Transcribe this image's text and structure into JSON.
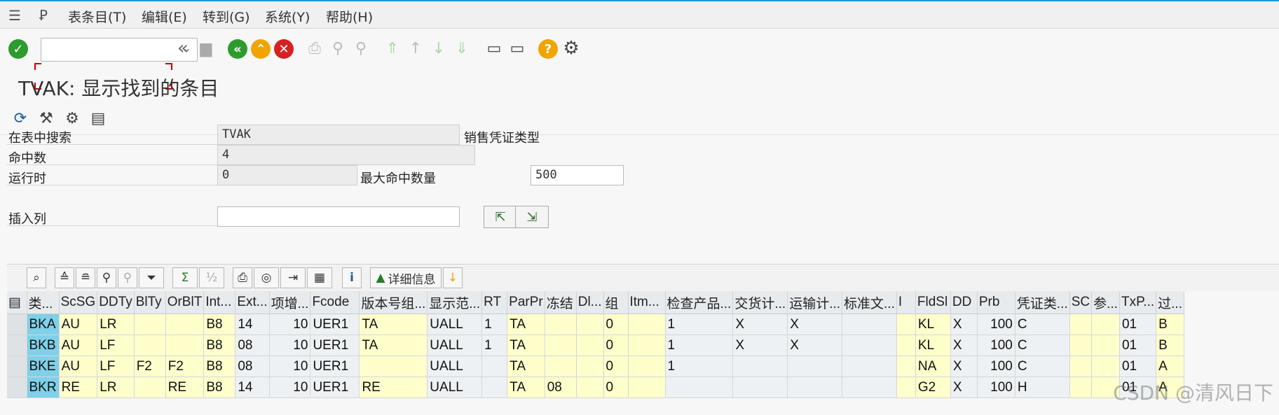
{
  "menu": {
    "items": [
      "表条目(T)",
      "编辑(E)",
      "转到(G)",
      "系统(Y)",
      "帮助(H)"
    ]
  },
  "toolbar": {
    "command_field_value": "",
    "icons": [
      "confirm-icon",
      "back-icon",
      "save-icon",
      "back-green-icon",
      "exit-icon",
      "cancel-icon",
      "print-icon",
      "find-icon",
      "find-next-icon",
      "first-page-icon",
      "prev-page-icon",
      "next-page-icon",
      "last-page-icon",
      "create-session-icon",
      "shortcut-icon",
      "help-icon",
      "settings-gear-icon"
    ]
  },
  "page": {
    "title": "TVAK: 显示找到的条目"
  },
  "search": {
    "table_label": "在表中搜索",
    "table_value": "TVAK",
    "table_desc": "销售凭证类型",
    "hits_label": "命中数",
    "hits_value": "4",
    "runtime_label": "运行时",
    "runtime_value": "0",
    "max_hits_label": "最大命中数量",
    "max_hits_value": "500",
    "insert_col_label": "插入列",
    "insert_col_value": ""
  },
  "gridtoolbar": {
    "details_label": "详细信息"
  },
  "grid": {
    "headers": [
      "类...",
      "ScSG",
      "DDTy",
      "BlTy",
      "OrBlT",
      "Int...",
      "Ext...",
      "项增...",
      "Fcode",
      "版本号组...",
      "显示范...",
      "RT",
      "ParPr",
      "冻结",
      "Dl...",
      "组",
      "Itm...",
      "检查产品...",
      "交货计...",
      "运输计...",
      "标准文...",
      "I",
      "FldSl",
      "DD",
      "Prb",
      "凭证类...",
      "SC",
      "参...",
      "TxP...",
      "过..."
    ],
    "rows": [
      [
        "BKA",
        "AU",
        "LR",
        "",
        "",
        "B8",
        "14",
        "10",
        "UER1",
        "TA",
        "UALL",
        "1",
        "TA",
        "",
        "",
        "0",
        "",
        "1",
        "X",
        "X",
        "",
        "",
        "KL",
        "X",
        "100",
        "C",
        "",
        "",
        "01",
        "B"
      ],
      [
        "BKB",
        "AU",
        "LF",
        "",
        "",
        "B8",
        "08",
        "10",
        "UER1",
        "TA",
        "UALL",
        "1",
        "TA",
        "",
        "",
        "0",
        "",
        "1",
        "X",
        "X",
        "",
        "",
        "KL",
        "X",
        "100",
        "C",
        "",
        "",
        "01",
        "B"
      ],
      [
        "BKE",
        "AU",
        "LF",
        "F2",
        "F2",
        "B8",
        "08",
        "10",
        "UER1",
        "",
        "UALL",
        "",
        "TA",
        "",
        "",
        "0",
        "",
        "1",
        "",
        "",
        "",
        "",
        "NA",
        "X",
        "100",
        "C",
        "",
        "",
        "01",
        "A"
      ],
      [
        "BKR",
        "RE",
        "LR",
        "",
        "RE",
        "B8",
        "14",
        "10",
        "UER1",
        "RE",
        "UALL",
        "",
        "TA",
        "08",
        "",
        "0",
        "",
        "",
        "",
        "",
        "",
        "",
        "G2",
        "X",
        "100",
        "H",
        "",
        "",
        "01",
        "A"
      ]
    ]
  },
  "watermark": "CSDN @清风日下",
  "colors": {
    "key": "#7fd0e8",
    "editable": "#ffffcc",
    "accent": "#1a9ad6"
  }
}
